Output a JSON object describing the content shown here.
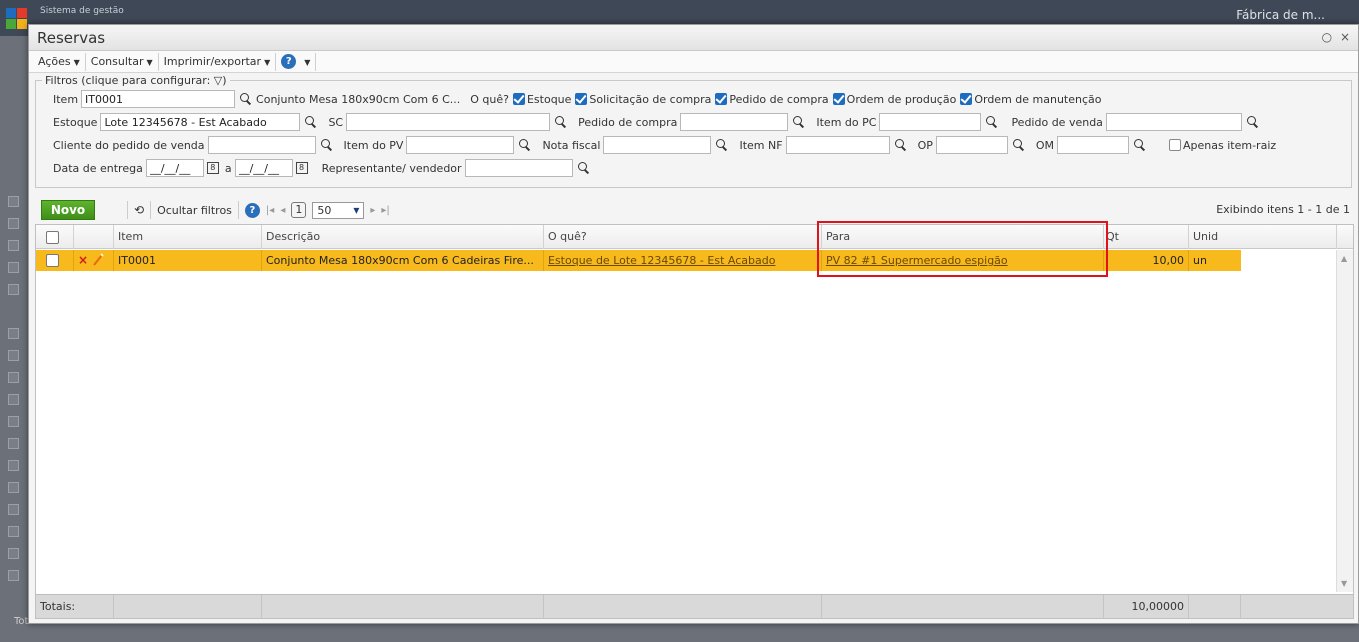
{
  "background": {
    "system_title": "Sistema de gestão",
    "company": "Fábrica de m...",
    "totals_label": "Totais:",
    "brand_colors": [
      "#1e6cc0",
      "#e23a2b",
      "#4aa83a",
      "#f2b21a"
    ]
  },
  "modal": {
    "title": "Reservas",
    "chat_icon": "💬",
    "close_icon": "×"
  },
  "menu": {
    "actions": "Ações",
    "consult": "Consultar",
    "print_export": "Imprimir/exportar",
    "help": "?"
  },
  "filters": {
    "legend": "Filtros (clique para configurar:",
    "legend_end": ")",
    "item_label": "Item",
    "item_value": "IT0001",
    "item_desc": "Conjunto Mesa 180x90cm Com 6 C...",
    "what_label": "O quê?",
    "what_options": [
      {
        "label": "Estoque",
        "checked": true
      },
      {
        "label": "Solicitação de compra",
        "checked": true
      },
      {
        "label": "Pedido de compra",
        "checked": true
      },
      {
        "label": "Ordem de produção",
        "checked": true
      },
      {
        "label": "Ordem de manutenção",
        "checked": true
      }
    ],
    "stock_label": "Estoque",
    "stock_value": "Lote 12345678 - Est Acabado",
    "sc_label": "SC",
    "po_label": "Pedido de compra",
    "po_item_label": "Item do PC",
    "so_label": "Pedido de venda",
    "so_client_label": "Cliente do pedido de venda",
    "so_item_label": "Item do PV",
    "invoice_label": "Nota fiscal",
    "invoice_item_label": "Item NF",
    "op_label": "OP",
    "om_label": "OM",
    "root_only_label": "Apenas item-raiz",
    "delivery_label": "Data de entrega",
    "date_from": "__/__/__",
    "date_to_label": "a",
    "date_to": "__/__/__",
    "rep_label": "Representante/ vendedor"
  },
  "toolbar": {
    "new_label": "Novo",
    "hide_filters": "Ocultar filtros",
    "page": "1",
    "page_size": "50",
    "showing": "Exibindo itens 1 - 1 de 1"
  },
  "grid": {
    "columns": [
      "Item",
      "Descrição",
      "O quê?",
      "Para",
      "Qt",
      "Unid"
    ],
    "rows": [
      {
        "item": "IT0001",
        "description": "Conjunto Mesa 180x90cm Com 6 Cadeiras Fire...",
        "what": "Estoque de Lote 12345678 - Est Acabado",
        "to": "PV 82 #1 Supermercado espigão",
        "qty": "10,00",
        "unit": "un"
      }
    ],
    "totals_label": "Totais:",
    "totals_qty": "10,00000",
    "row_highlight_color": "#f7b91c",
    "callout_color": "#e0121a"
  }
}
